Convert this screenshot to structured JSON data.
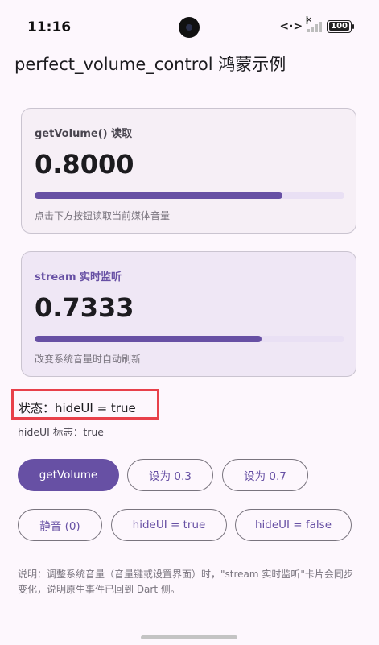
{
  "status_bar": {
    "time": "11:16",
    "x_mark": "×",
    "battery": "100"
  },
  "app": {
    "title": "perfect_volume_control 鸿蒙示例"
  },
  "cards": {
    "get": {
      "label": "getVolume() 读取",
      "value": "0.8000",
      "progress": 0.8,
      "hint": "点击下方按钮读取当前媒体音量"
    },
    "stream": {
      "label": "stream 实时监听",
      "value": "0.7333",
      "progress": 0.7333,
      "hint": "改变系统音量时自动刷新"
    }
  },
  "status": {
    "text": "状态：hideUI = true",
    "flag": "hideUI 标志：true"
  },
  "buttons": {
    "get_volume": "getVolume",
    "set_03": "设为 0.3",
    "set_07": "设为 0.7",
    "mute": "静音 (0)",
    "hide_true": "hideUI = true",
    "hide_false": "hideUI = false"
  },
  "note": "说明：调整系统音量（音量键或设置界面）时，\"stream 实时监听\"卡片会同步变化，说明原生事件已回到 Dart 侧。",
  "colors": {
    "primary": "#6750a4",
    "track": "#e9e0f4",
    "highlight_border": "#e8404a",
    "background": "#fdf7fd"
  },
  "icons": [
    "camera-cutout-icon",
    "data-transfer-icon",
    "signal-icon",
    "battery-icon"
  ]
}
